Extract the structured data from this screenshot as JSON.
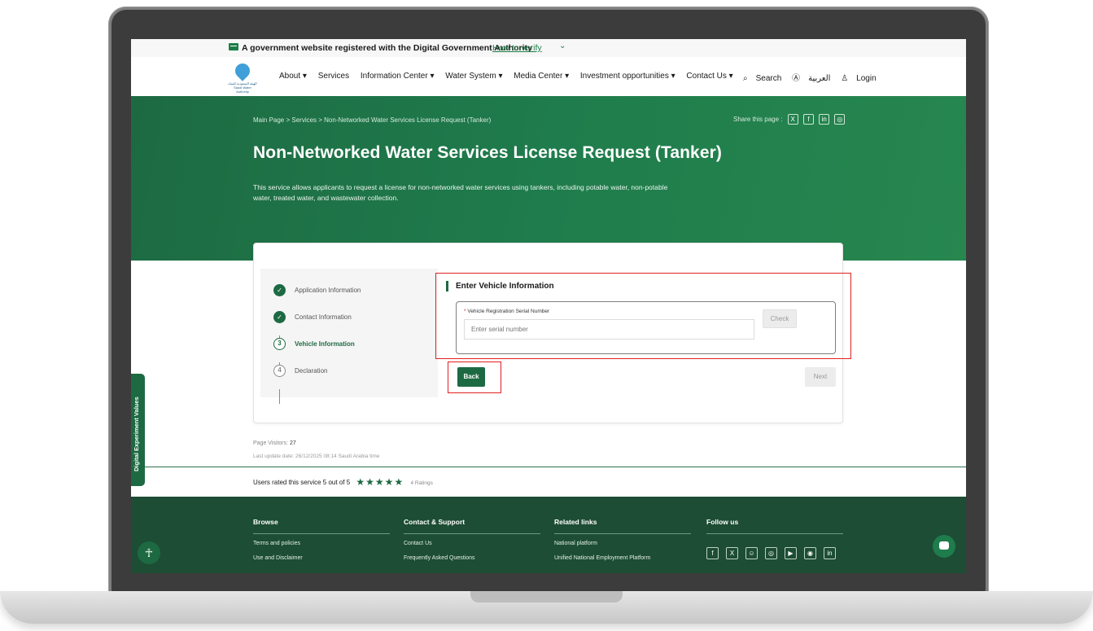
{
  "govbar": {
    "text": "A government website registered with the Digital Government Authority",
    "verify": "How to verify"
  },
  "header": {
    "logo_text": "الهيئة السعودية للمياه Saudi Water Authority",
    "nav": [
      "About ▾",
      "Services",
      "Information Center ▾",
      "Water System ▾",
      "Media Center ▾",
      "Investment opportunities ▾",
      "Contact Us ▾"
    ],
    "search": "Search",
    "language": "العربية",
    "login": "Login"
  },
  "hero": {
    "breadcrumb": "Main Page  >  Services  >  Non-Networked Water Services License Request (Tanker)",
    "share_label": "Share this page :",
    "title": "Non-Networked Water Services License Request (Tanker)",
    "description": "This service allows applicants to request a license for non-networked water services using tankers, including potable water, non-potable water, treated water, and wastewater collection."
  },
  "steps": [
    {
      "label": "Application Information",
      "mark": "✓",
      "state": "done"
    },
    {
      "label": "Contact Information",
      "mark": "✓",
      "state": "done"
    },
    {
      "label": "Vehicle Information",
      "mark": "3",
      "state": "current"
    },
    {
      "label": "Declaration",
      "mark": "4",
      "state": "todo"
    }
  ],
  "form": {
    "heading": "Enter Vehicle Information",
    "field_label": "Vehicle Registration Serial Number",
    "required_mark": "*",
    "placeholder": "Enter serial number",
    "check": "Check",
    "back": "Back",
    "next": "Next"
  },
  "meta": {
    "visitors_label": "Page Visitors:",
    "visitors_count": "27",
    "updated": "Last update date: 26/12/2025 08:14 Saudi Arabia time",
    "rating_text": "Users rated this service 5 out of 5",
    "stars": "★★★★★",
    "ratings_count": "4 Ratings"
  },
  "side_tab": "Digital Experiment Values",
  "footer": {
    "browse": {
      "heading": "Browse",
      "items": [
        "Terms and policies",
        "Use and Disclaimer"
      ]
    },
    "support": {
      "heading": "Contact & Support",
      "items": [
        "Contact Us",
        "Frequently Asked Questions"
      ]
    },
    "related": {
      "heading": "Related links",
      "items": [
        "National platform",
        "Unified National Employment Platform"
      ]
    },
    "follow": {
      "heading": "Follow us"
    }
  },
  "colors": {
    "primary": "#1d6a42",
    "highlight": "#e02020",
    "footer": "#1d4d34"
  }
}
